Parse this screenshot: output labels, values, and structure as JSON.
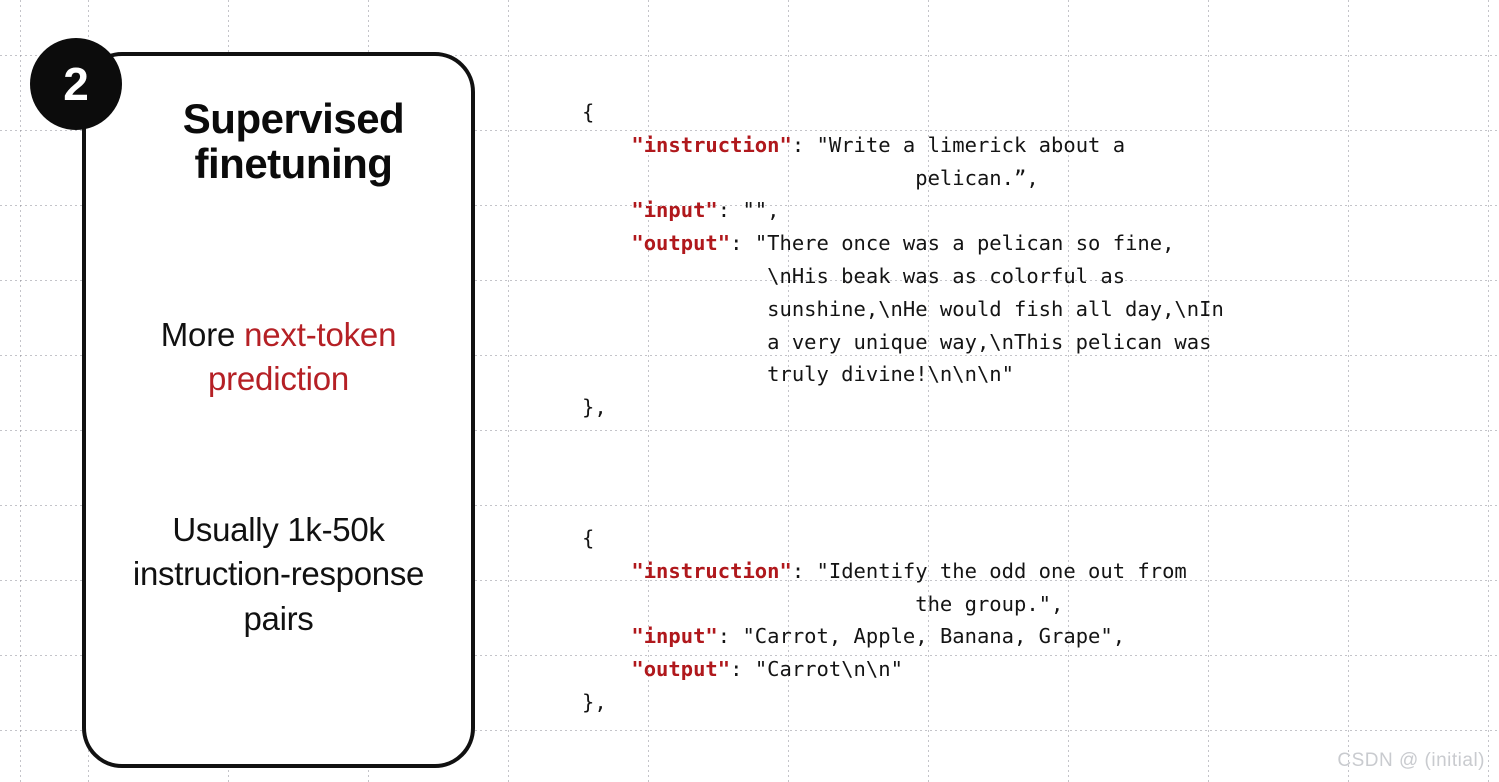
{
  "card": {
    "badge_number": "2",
    "title_line1": "Supervised",
    "title_line2": "finetuning",
    "desc1_prefix": "More ",
    "desc1_accent": "next-token prediction",
    "desc2": "Usually 1k-50k instruction-response pairs",
    "accent_color": "#B52025",
    "border_color": "#111111",
    "badge_bg": "#0c0c0c"
  },
  "code": {
    "key_color": "#B0181C",
    "text_color": "#141414",
    "blocks": [
      {
        "open_brace": "{",
        "close_brace": "},",
        "entries": [
          {
            "key": "\"instruction\"",
            "sep": ": ",
            "value_lines": [
              "\"Write a limerick about a",
              "        pelican.”,"
            ]
          },
          {
            "key": "\"input\"",
            "sep": ": ",
            "value_lines": [
              "\"\","
            ]
          },
          {
            "key": "\"output\"",
            "sep": ": ",
            "value_lines": [
              "\"There once was a pelican so fine,",
              " \\nHis beak was as colorful as",
              " sunshine,\\nHe would fish all day,\\nIn",
              " a very unique way,\\nThis pelican was",
              " truly divine!\\n\\n\\n\""
            ]
          }
        ]
      },
      {
        "open_brace": "{",
        "close_brace": "},",
        "entries": [
          {
            "key": "\"instruction\"",
            "sep": ": ",
            "value_lines": [
              "\"Identify the odd one out from",
              "        the group.\","
            ]
          },
          {
            "key": "\"input\"",
            "sep": ": ",
            "value_lines": [
              "\"Carrot, Apple, Banana, Grape\","
            ]
          },
          {
            "key": "\"output\"",
            "sep": ": ",
            "value_lines": [
              "\"Carrot\\n\\n\""
            ]
          }
        ]
      }
    ]
  },
  "watermark": {
    "text": "CSDN @ (initial)"
  }
}
